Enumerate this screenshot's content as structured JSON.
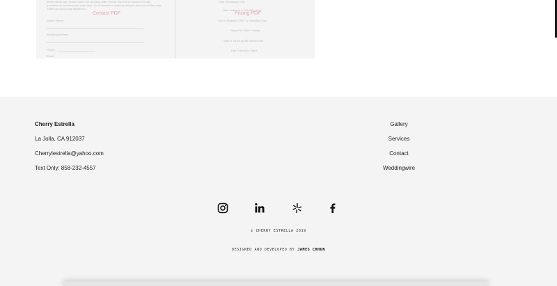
{
  "pdf_preview": {
    "contact_link": "Contact PDF",
    "pricing_link": "Pricing PDF",
    "left_lines": [
      "prefer will be due seven before the wedding date. Please feel free to contact me with",
      "questions or concerns you may have. I look forward to working with you and your bridal party.",
      "Thank you and congratulations!"
    ],
    "left_fields": [
      "Bride's Name:",
      "Wedding Address:",
      "Phone:",
      "Email:"
    ],
    "right_items": [
      "Hair or Makeup Only",
      "Hair / Makeup on Wedding Day",
      "Hair or Makeup ONLY on Wedding Day",
      "Airport for Style Change",
      "Stay in Touch up $$ Hourly Rate",
      "Hair Extension Styles"
    ]
  },
  "footer": {
    "contact": {
      "name": "Cherry Estrella",
      "location": "La Jolla, CA 912037",
      "email": "Cherrylestrella@yahoo.com",
      "phone": "Text Only: 858-232-4557"
    },
    "nav": [
      "Gallery",
      "Services",
      "Contact",
      "Weddingwire"
    ],
    "socials": [
      "instagram-icon",
      "linkedin-icon",
      "yelp-icon",
      "facebook-icon"
    ],
    "copyright": "© CHERRY ESTRELLA 2019",
    "credit_prefix": "DESIGNED AND DEVELOPED BY",
    "credit_name": "JAMES CHHUN"
  }
}
